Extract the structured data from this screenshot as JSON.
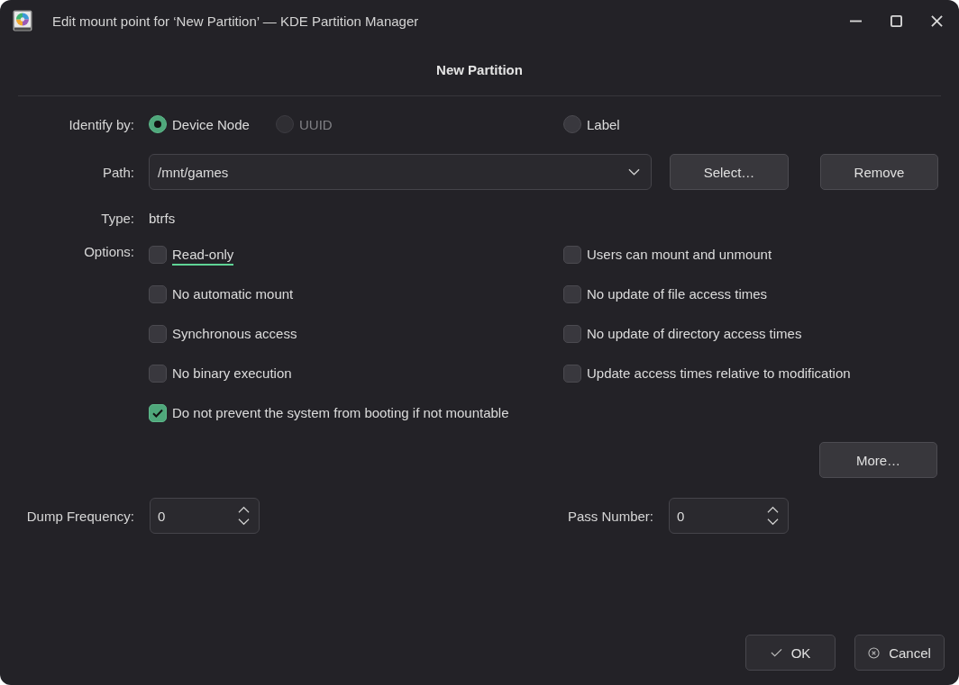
{
  "window": {
    "title": "Edit mount point for ‘New Partition’ — KDE Partition Manager"
  },
  "heading": "New Partition",
  "identify_by": {
    "label": "Identify by:",
    "options": [
      {
        "label": "Device Node",
        "selected": true,
        "disabled": false
      },
      {
        "label": "UUID",
        "selected": false,
        "disabled": true
      },
      {
        "label": "Label",
        "selected": false,
        "disabled": false
      }
    ]
  },
  "path": {
    "label": "Path:",
    "value": "/mnt/games",
    "buttons": [
      "Select…",
      "Remove"
    ]
  },
  "type": {
    "label": "Type:",
    "value": "btrfs"
  },
  "options": {
    "label": "Options:",
    "items": [
      {
        "label": "Read-only",
        "checked": false,
        "focused": true
      },
      {
        "label": "Users can mount and unmount",
        "checked": false,
        "focused": false
      },
      {
        "label": "No automatic mount",
        "checked": false,
        "focused": false
      },
      {
        "label": "No update of file access times",
        "checked": false,
        "focused": false
      },
      {
        "label": "Synchronous access",
        "checked": false,
        "focused": false
      },
      {
        "label": "No update of directory access times",
        "checked": false,
        "focused": false
      },
      {
        "label": "No binary execution",
        "checked": false,
        "focused": false
      },
      {
        "label": "Update access times relative to modification",
        "checked": false,
        "focused": false
      },
      {
        "label": "Do not prevent the system from booting if not mountable",
        "checked": true,
        "focused": false
      }
    ],
    "more_button": "More…"
  },
  "dump_frequency": {
    "label": "Dump Frequency:",
    "value": "0"
  },
  "pass_number": {
    "label": "Pass Number:",
    "value": "0"
  },
  "dialog_buttons": [
    {
      "label": "OK",
      "kind": "ok"
    },
    {
      "label": "Cancel",
      "kind": "cancel"
    }
  ]
}
